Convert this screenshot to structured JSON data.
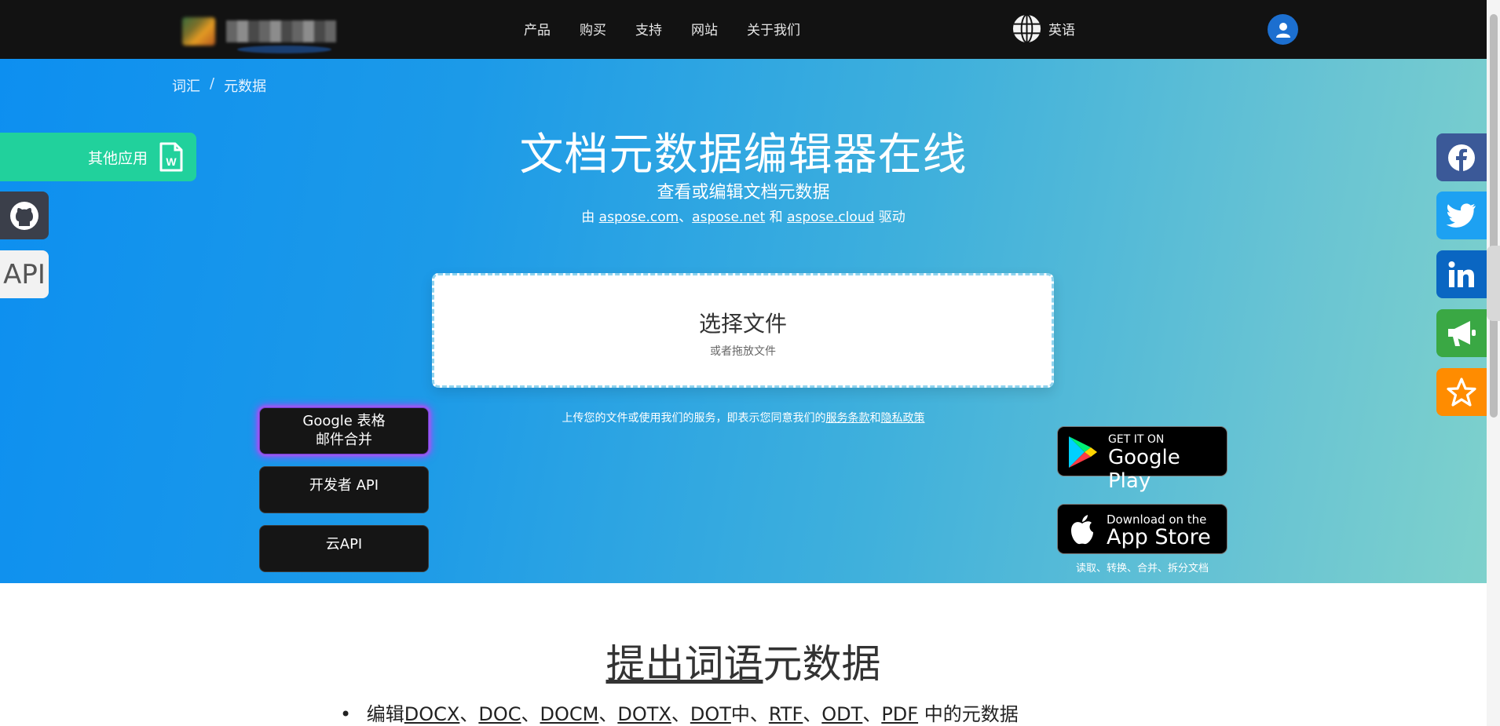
{
  "header": {
    "nav": [
      "产品",
      "购买",
      "支持",
      "网站",
      "关于我们"
    ],
    "language": "英语"
  },
  "breadcrumb": {
    "items": [
      "词汇",
      "元数据"
    ],
    "separator": "/"
  },
  "hero": {
    "title": "文档元数据编辑器在线",
    "subtitle": "查看或编辑文档元数据",
    "powered_prefix": "由",
    "powered_links": [
      "aspose.com",
      "aspose.net",
      "aspose.cloud"
    ],
    "powered_sep1": "、",
    "powered_sep2": "和",
    "powered_suffix": "驱动",
    "dropzone": {
      "choose": "选择文件",
      "drop": "或者拖放文件"
    },
    "terms_prefix": "上传您的文件或使用我们的服务，即表示您同意我们的",
    "terms_link": "服务条款",
    "terms_and": "和",
    "privacy_link": "隐私政策",
    "buttons": {
      "google_line1": "Google 表格",
      "google_line2": "邮件合并",
      "developer_api": "开发者 API",
      "cloud_api": "云API"
    },
    "stores": {
      "google_small": "GET IT ON",
      "google_big": "Google Play",
      "apple_small": "Download on the",
      "apple_big": "App Store",
      "caption": "读取、转换、合并、拆分文档"
    }
  },
  "left_floating": {
    "other_apps": "其他应用",
    "api": "API"
  },
  "colors": {
    "topbar": "#121212",
    "other_apps": "#21d19c",
    "facebook": "#3b5998",
    "twitter": "#1da1f2",
    "linkedin": "#0a66c2",
    "announce": "#3aa844",
    "star": "#ff8c00"
  },
  "icons": {
    "social": [
      "facebook-icon",
      "twitter-icon",
      "linkedin-icon",
      "megaphone-icon",
      "star-icon"
    ]
  },
  "section": {
    "title_underlined": "提出词语",
    "title_rest": "元数据",
    "bullet_prefix": "编辑",
    "formats_doc": [
      "DOCX",
      "DOC",
      "DOCM",
      "DOTX",
      "DOT"
    ],
    "mid": "中、",
    "formats_other": [
      "RTF",
      "ODT",
      "PDF"
    ],
    "bullet_suffix": " 中的元数据"
  }
}
